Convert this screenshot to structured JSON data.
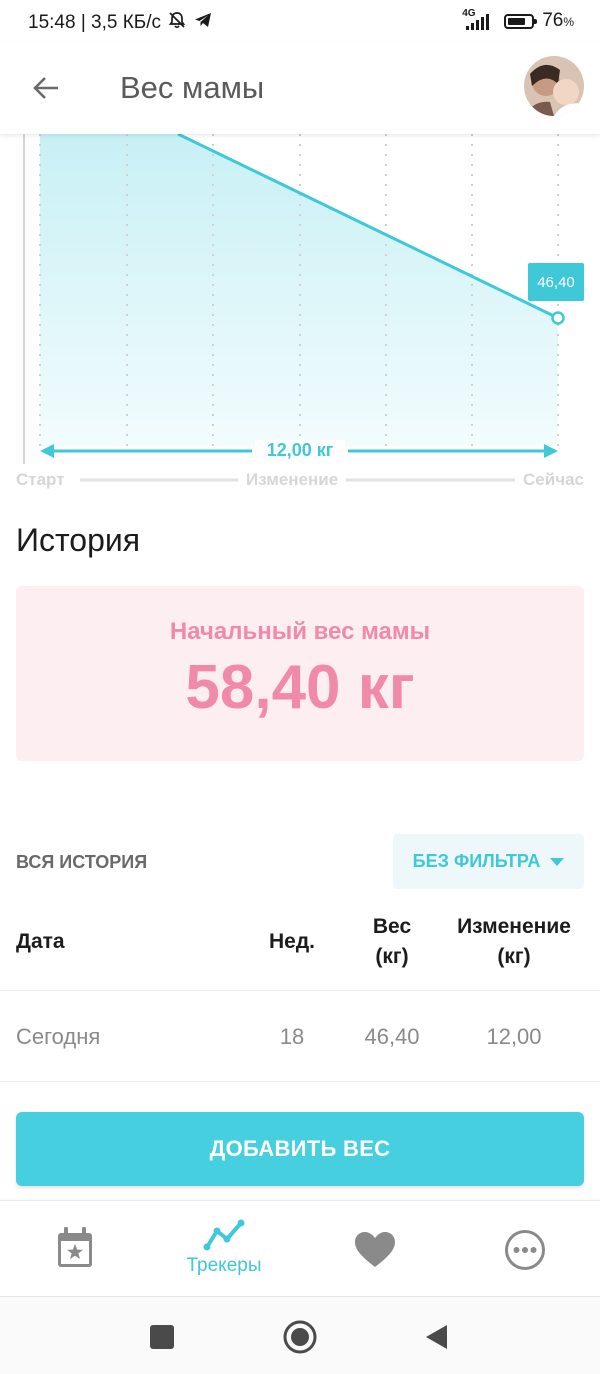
{
  "status_bar": {
    "time_speed": "15:48 | 3,5 КБ/с",
    "network": "4G",
    "battery_percent": "76",
    "battery_unit": "%",
    "battery_level": 0.76
  },
  "header": {
    "title": "Вес мамы"
  },
  "chart_data": {
    "type": "area",
    "point_value_label": "46,40",
    "change_label": "12,00 кг",
    "x_labels": [
      "Старт",
      "Изменение",
      "Сейчас"
    ],
    "color": "#3fc8d8"
  },
  "history": {
    "title": "История",
    "initial_weight_label": "Начальный вес мамы",
    "initial_weight_value": "58,40 кг",
    "all_history_label": "ВСЯ ИСТОРИЯ",
    "filter_label": "БЕЗ ФИЛЬТРА",
    "columns": {
      "date": "Дата",
      "week": "Нед.",
      "weight_line1": "Вес",
      "weight_line2": "(кг)",
      "change_line1": "Изменение",
      "change_line2": "(кг)"
    },
    "rows": [
      {
        "date": "Сегодня",
        "week": "18",
        "weight": "46,40",
        "change": "12,00"
      }
    ]
  },
  "add_button_label": "ДОБАВИТЬ ВЕС",
  "bottom_nav": {
    "items": [
      {
        "icon": "calendar-star-icon",
        "label": ""
      },
      {
        "icon": "trend-line-icon",
        "label": "Трекеры",
        "active": true
      },
      {
        "icon": "heart-icon",
        "label": ""
      },
      {
        "icon": "more-dots-icon",
        "label": ""
      }
    ]
  },
  "colors": {
    "accent": "#3fc8d8",
    "pink": "#f08aa8",
    "pink_bg": "#fdeef2"
  }
}
